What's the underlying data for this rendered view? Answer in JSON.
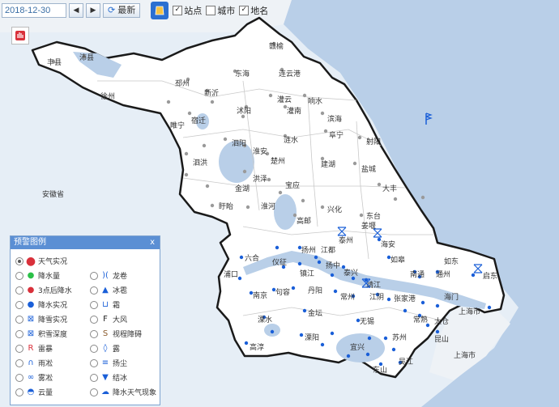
{
  "toolbar": {
    "date": "2018-12-30",
    "latest_label": "最新",
    "layers": [
      {
        "label": "站点",
        "checked": true
      },
      {
        "label": "城市",
        "checked": false
      },
      {
        "label": "地名",
        "checked": true
      }
    ]
  },
  "map": {
    "land_color": "#ffffff",
    "water_color": "#b9cfe8",
    "outside_color": "#e6eef6",
    "border_color": "#222222",
    "station_color": "#1a5fd8",
    "place_labels": [
      {
        "name": "丰县"
      },
      {
        "name": "沛县"
      },
      {
        "name": "赣榆"
      },
      {
        "name": "连云港"
      },
      {
        "name": "东海"
      },
      {
        "name": "邳州"
      },
      {
        "name": "新沂"
      },
      {
        "name": "徐州"
      },
      {
        "name": "灌云"
      },
      {
        "name": "灌南"
      },
      {
        "name": "响水"
      },
      {
        "name": "滨海"
      },
      {
        "name": "沭阳"
      },
      {
        "name": "宿迁"
      },
      {
        "name": "睢宁"
      },
      {
        "name": "泗阳"
      },
      {
        "name": "涟水"
      },
      {
        "name": "阜宁"
      },
      {
        "name": "射阳"
      },
      {
        "name": "淮安"
      },
      {
        "name": "楚州"
      },
      {
        "name": "泗洪"
      },
      {
        "name": "洪泽"
      },
      {
        "name": "建湖"
      },
      {
        "name": "盐城"
      },
      {
        "name": "金湖"
      },
      {
        "name": "宝应"
      },
      {
        "name": "大丰"
      },
      {
        "name": "盱眙"
      },
      {
        "name": "高邮"
      },
      {
        "name": "兴化"
      },
      {
        "name": "东台"
      },
      {
        "name": "姜堰"
      },
      {
        "name": "泰州"
      },
      {
        "name": "海安"
      },
      {
        "name": "如皋"
      },
      {
        "name": "如东"
      },
      {
        "name": "六合"
      },
      {
        "name": "仪征"
      },
      {
        "name": "扬州"
      },
      {
        "name": "江都"
      },
      {
        "name": "扬中"
      },
      {
        "name": "镇江"
      },
      {
        "name": "泰兴"
      },
      {
        "name": "靖江"
      },
      {
        "name": "南通"
      },
      {
        "name": "通州"
      },
      {
        "name": "启东"
      },
      {
        "name": "海门"
      },
      {
        "name": "浦口"
      },
      {
        "name": "南京"
      },
      {
        "name": "句容"
      },
      {
        "name": "丹阳"
      },
      {
        "name": "常州"
      },
      {
        "name": "江阴"
      },
      {
        "name": "张家港"
      },
      {
        "name": "常熟"
      },
      {
        "name": "太仓"
      },
      {
        "name": "金坛"
      },
      {
        "name": "溧水"
      },
      {
        "name": "无锡"
      },
      {
        "name": "昆山"
      },
      {
        "name": "苏州"
      },
      {
        "name": "溧阳"
      },
      {
        "name": "宜兴"
      },
      {
        "name": "高淳"
      },
      {
        "name": "吴江"
      },
      {
        "name": "东山"
      },
      {
        "name": "上海市"
      },
      {
        "name": "上海市"
      },
      {
        "name": "安徽省"
      },
      {
        "name": "淮河"
      }
    ]
  },
  "legend": {
    "title": "预警图例",
    "close": "x",
    "items": [
      {
        "label": "天气实况",
        "icon": "weather-observation-icon",
        "color": "#d9303a",
        "selected": true
      },
      {
        "label": "降水量",
        "icon": "precipitation-dot-icon",
        "color": "#2bc048"
      },
      {
        "label": "龙卷",
        "icon": "tornado-icon",
        "color": "#1a5fd8"
      },
      {
        "label": "3点后降水",
        "icon": "precipitation-3h-dot-icon",
        "color": "#d9303a"
      },
      {
        "label": "冰雹",
        "icon": "hail-icon",
        "color": "#1a5fd8"
      },
      {
        "label": "降水实况",
        "icon": "precipitation-obs-dot-icon",
        "color": "#1a5fd8"
      },
      {
        "label": "霜",
        "icon": "frost-icon",
        "color": "#1a5fd8"
      },
      {
        "label": "降雪实况",
        "icon": "snow-icon",
        "color": "#1a5fd8"
      },
      {
        "label": "大风",
        "icon": "gale-flag-icon",
        "color": "#222222"
      },
      {
        "label": "积雪深度",
        "icon": "snow-depth-icon",
        "color": "#1a5fd8"
      },
      {
        "label": "视程障碍",
        "icon": "visibility-obstruction-icon",
        "color": "#8a5a2b"
      },
      {
        "label": "雷暴",
        "icon": "thunderstorm-icon",
        "color": "#d9303a"
      },
      {
        "label": "露",
        "icon": "dew-icon",
        "color": "#1a5fd8"
      },
      {
        "label": "雨凇",
        "icon": "glaze-icon",
        "color": "#1a5fd8"
      },
      {
        "label": "扬尘",
        "icon": "dust-icon",
        "color": "#1a5fd8"
      },
      {
        "label": "雾凇",
        "icon": "rime-icon",
        "color": "#1a5fd8"
      },
      {
        "label": "结冰",
        "icon": "ice-icon",
        "color": "#1a5fd8"
      },
      {
        "label": "云量",
        "icon": "cloud-amount-icon",
        "color": "#1a5fd8"
      },
      {
        "label": "降水天气现象",
        "icon": "precip-weather-icon",
        "color": "#1a5fd8"
      }
    ]
  }
}
